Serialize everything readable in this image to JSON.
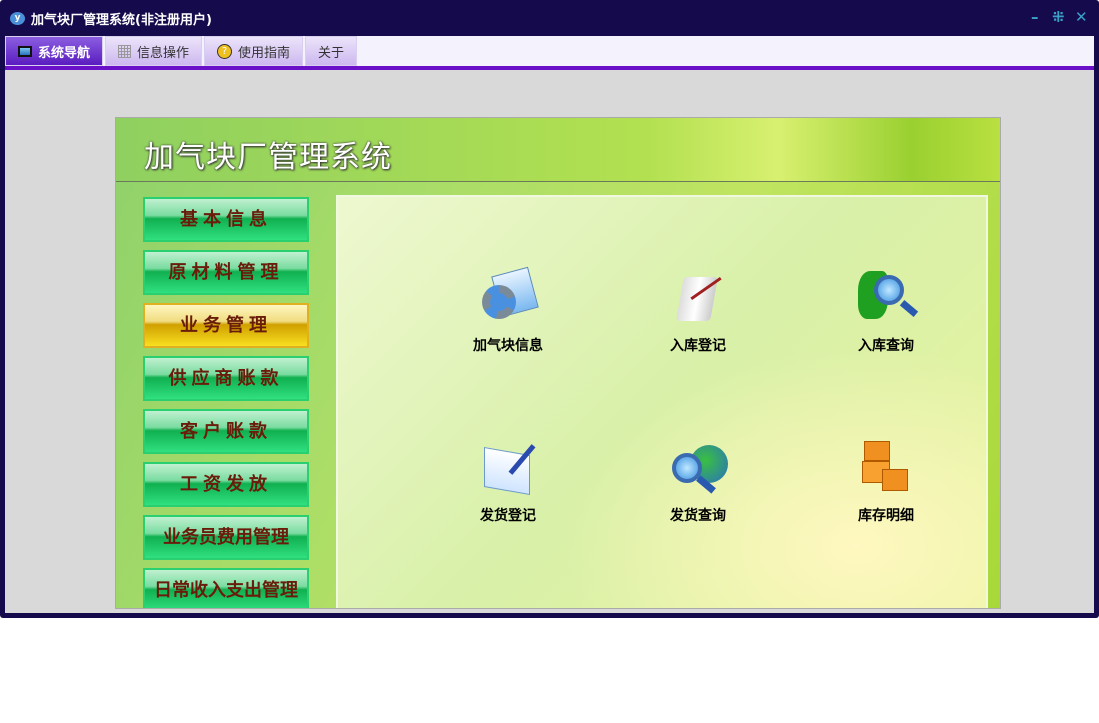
{
  "window": {
    "title": "加气块厂管理系统(非注册用户)",
    "minimize": "–",
    "restore": "⁜",
    "close": "✕"
  },
  "tabs": [
    {
      "label": "系统导航",
      "icon": "monitor-icon"
    },
    {
      "label": "信息操作",
      "icon": "grid-icon"
    },
    {
      "label": "使用指南",
      "icon": "help-icon"
    },
    {
      "label": "关于"
    }
  ],
  "header": {
    "title": "加气块厂管理系统"
  },
  "nav": [
    "基本信息",
    "原材料管理",
    "业务管理",
    "供应商账款",
    "客户账款",
    "工资发放",
    "业务员费用管理",
    "日常收入支出管理"
  ],
  "nav_selected": "业务管理",
  "items": [
    {
      "label": "加气块信息",
      "icon": "gear-folder-icon"
    },
    {
      "label": "入库登记",
      "icon": "scroll-pen-icon"
    },
    {
      "label": "入库查询",
      "icon": "map-search-icon"
    },
    {
      "label": "发货登记",
      "icon": "document-pen-icon"
    },
    {
      "label": "发货查询",
      "icon": "globe-search-icon"
    },
    {
      "label": "库存明细",
      "icon": "boxes-icon"
    }
  ]
}
